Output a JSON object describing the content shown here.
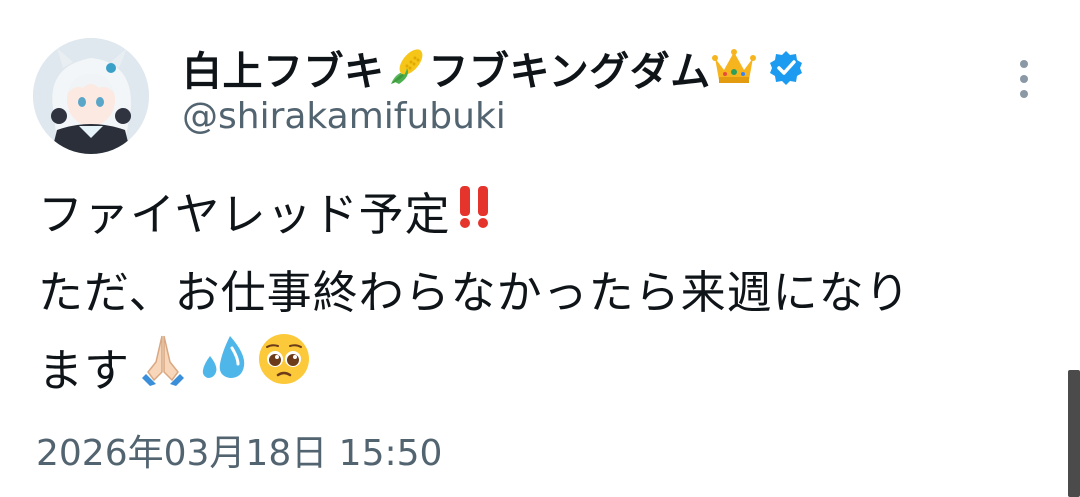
{
  "post": {
    "author": {
      "name_part1": "白上フブキ",
      "name_part2": "フブキングダム",
      "handle": "@shirakamifubuki",
      "verified": true
    },
    "body_lines": [
      "ファイヤレッド予定",
      "ただ、お仕事終わらなかったら来週になり",
      "ます"
    ],
    "timestamp": "2026年03月18日 15:50"
  },
  "icons": {
    "corn": "corn-emoji",
    "crown": "crown-emoji",
    "verified": "verified-badge-icon",
    "more": "more-options-icon",
    "exclamation": "double-exclamation-emoji",
    "pray": "folded-hands-emoji",
    "sweat": "sweat-droplets-emoji",
    "pleading": "pleading-face-emoji"
  },
  "colors": {
    "text": "#0f1419",
    "secondary": "#536471",
    "verified_blue": "#1d9bf0"
  }
}
